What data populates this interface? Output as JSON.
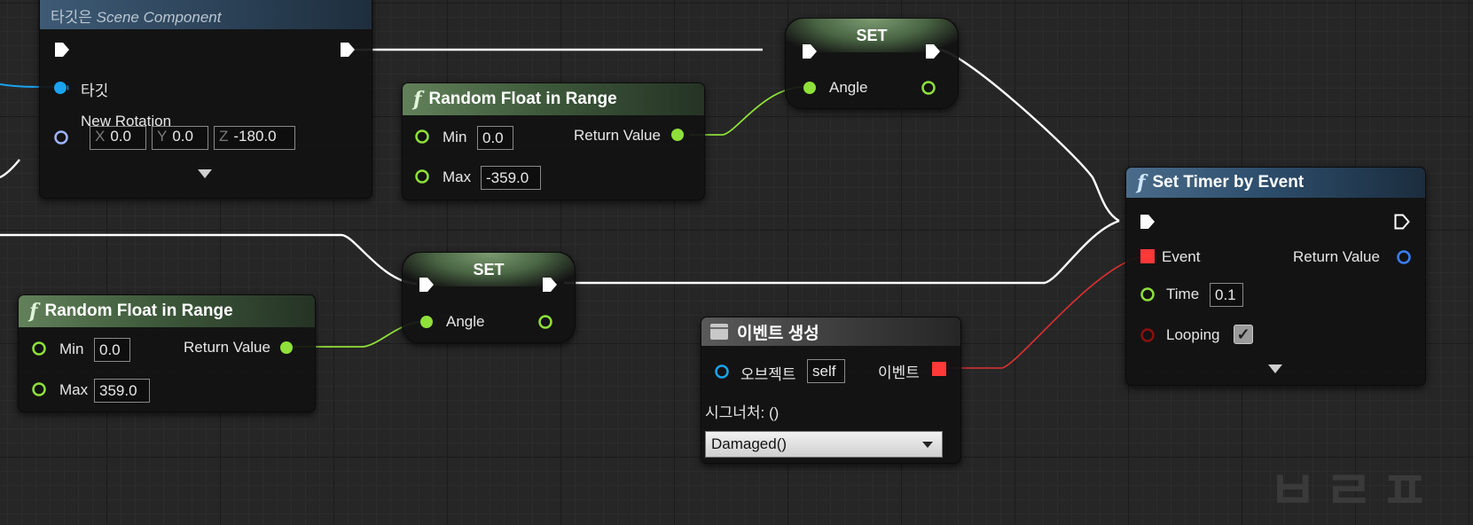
{
  "colors": {
    "exec": "#ffffff",
    "float": "#8fe03a",
    "object": "#1aa3f0",
    "struct": "#a0b4ff",
    "delegate": "#ff3838",
    "bool": "#8a1010",
    "event_out": "#3a7fff"
  },
  "icons": {
    "function": "f",
    "exec": "exec-arrow-icon",
    "dropdown": "chevron-down-icon",
    "event": "event-node-icon"
  },
  "rotation_node": {
    "target_subtitle_prefix": "타깃은",
    "target_subtitle_class": "Scene Component",
    "target_pin": "타깃",
    "new_rotation_pin": "New Rotation",
    "x_label": "X",
    "x_value": "0.0",
    "y_label": "Y",
    "y_value": "0.0",
    "z_label": "Z",
    "z_value": "-180.0"
  },
  "random_float_top": {
    "title": "Random Float in Range",
    "min_label": "Min",
    "min_value": "0.0",
    "max_label": "Max",
    "max_value": "-359.0",
    "return_label": "Return Value"
  },
  "random_float_bottom": {
    "title": "Random Float in Range",
    "min_label": "Min",
    "min_value": "0.0",
    "max_label": "Max",
    "max_value": "359.0",
    "return_label": "Return Value"
  },
  "set_top": {
    "title": "SET",
    "pin": "Angle"
  },
  "set_bottom": {
    "title": "SET",
    "pin": "Angle"
  },
  "create_event": {
    "title": "이벤트 생성",
    "object_label": "오브젝트",
    "object_value": "self",
    "event_label": "이벤트",
    "signature_label": "시그너처: ()",
    "selected_function": "Damaged()"
  },
  "set_timer": {
    "title": "Set Timer by Event",
    "event_label": "Event",
    "return_label": "Return Value",
    "time_label": "Time",
    "time_value": "0.1",
    "looping_label": "Looping",
    "looping_checked": true,
    "check_glyph": "✓"
  },
  "watermark_text": "ㅂㄹㅍ"
}
